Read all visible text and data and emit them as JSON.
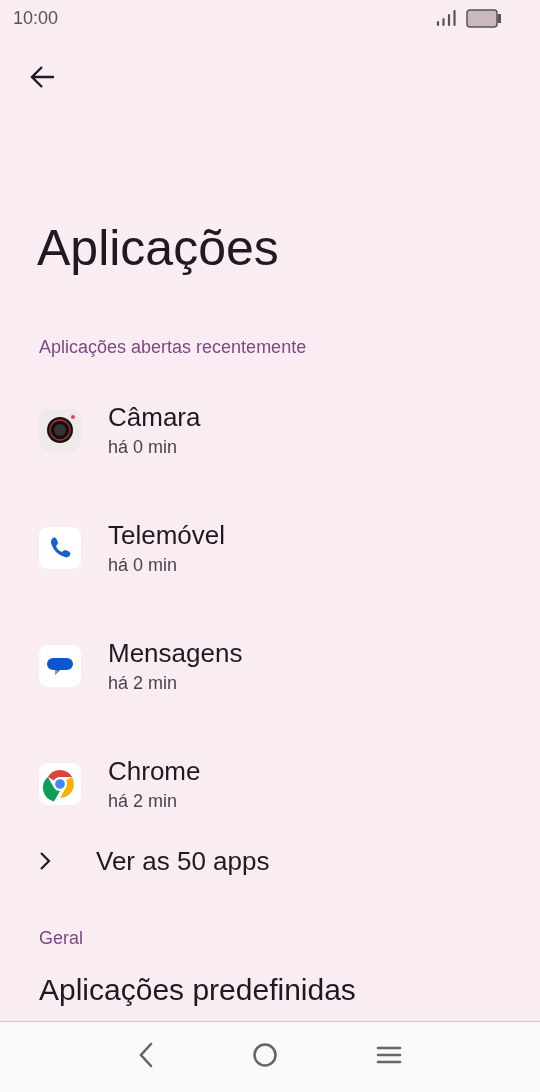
{
  "status_bar": {
    "time": "10:00"
  },
  "page": {
    "title": "Aplicações"
  },
  "recent_section": {
    "header": "Aplicações abertas recentemente",
    "apps": [
      {
        "kind": "camera",
        "name": "Câmara",
        "last_opened": "há 0 min"
      },
      {
        "kind": "phone",
        "name": "Telemóvel",
        "last_opened": "há 0 min"
      },
      {
        "kind": "messages",
        "name": "Mensagens",
        "last_opened": "há 2 min"
      },
      {
        "kind": "browser",
        "name": "Chrome",
        "last_opened": "há 2 min"
      }
    ],
    "see_all": "Ver as 50 apps"
  },
  "general_section": {
    "header": "Geral",
    "items": [
      "Aplicações predefinidas"
    ]
  }
}
